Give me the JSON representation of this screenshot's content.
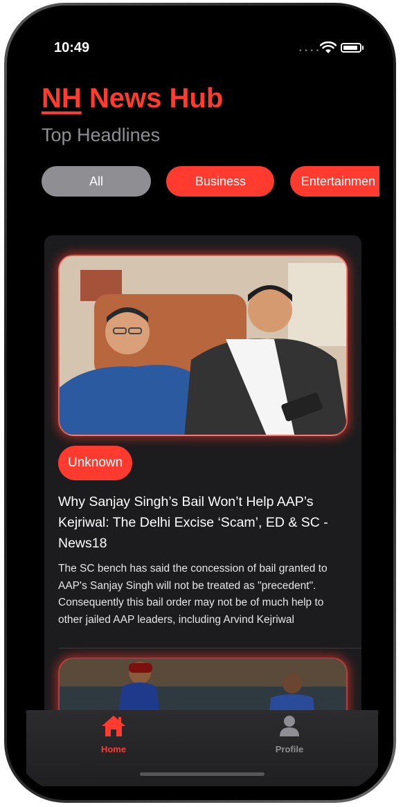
{
  "status_bar": {
    "time": "10:49"
  },
  "header": {
    "logo_text": "NH",
    "app_name": "News Hub",
    "subtitle": "Top Headlines"
  },
  "categories": [
    {
      "label": "All",
      "selected": true
    },
    {
      "label": "Business",
      "selected": false
    },
    {
      "label": "Entertainmen",
      "selected": false
    }
  ],
  "articles": [
    {
      "source": "Unknown",
      "headline": "Why Sanjay Singh’s Bail Won’t Help AAP’s Kejriwal: The Delhi Excise ‘Scam’, ED & SC - News18",
      "description": "The SC bench has said the concession of bail granted to AAP's Sanjay Singh will not be treated as \"precedent\". Consequently this bail order may not be of much help to other jailed AAP leaders, including Arvind Kejriwal"
    }
  ],
  "tab_bar": {
    "home_label": "Home",
    "profile_label": "Profile"
  },
  "colors": {
    "accent": "#ff3b30",
    "background": "#000000",
    "card": "#1c1c1e",
    "chip_selected": "#8e8e93"
  }
}
